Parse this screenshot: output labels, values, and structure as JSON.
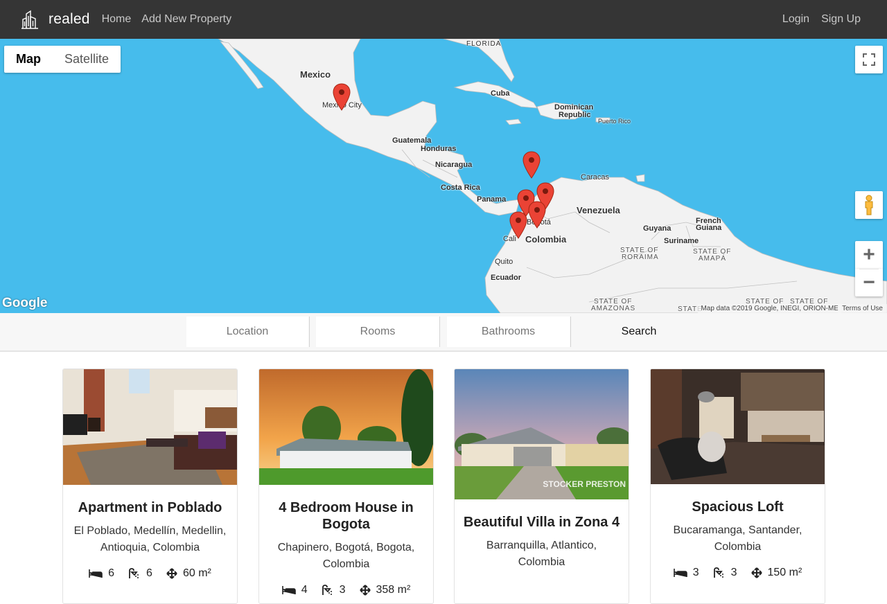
{
  "nav": {
    "brand": "realed",
    "links": [
      "Home",
      "Add New Property"
    ],
    "right_links": [
      "Login",
      "Sign Up"
    ]
  },
  "map": {
    "type_controls": [
      "Map",
      "Satellite"
    ],
    "labels": {
      "florida": "FLORIDA",
      "mexico": "Mexico",
      "mexico_city": "Mexico City",
      "cuba": "Cuba",
      "dominican_republic_1": "Dominican",
      "dominican_republic_2": "Republic",
      "puerto_rico": "Puerto Rico",
      "guatemala": "Guatemala",
      "honduras": "Honduras",
      "nicaragua": "Nicaragua",
      "costa_rica": "Costa Rica",
      "panama": "Panama",
      "caracas": "Caracas",
      "venezuela": "Venezuela",
      "bogota": "Bogotá",
      "cali": "Cali",
      "colombia": "Colombia",
      "guyana": "Guyana",
      "suriname": "Suriname",
      "french_guiana_1": "French",
      "french_guiana_2": "Guiana",
      "state_roraima_1": "STATE OF",
      "state_roraima_2": "RORAIMA",
      "state_amapa_1": "STATE OF",
      "state_amapa_2": "AMAPÁ",
      "quito": "Quito",
      "ecuador": "Ecuador",
      "state_amazonas_1": "STATE OF",
      "state_amazonas_2": "AMAZONAS",
      "state_bottom": "STATE",
      "state_right_1": "STATE OF",
      "state_right_2": "STATE OF"
    },
    "google_logo": "Google",
    "attribution": "Map data ©2019 Google, INEGI, ORION-ME",
    "terms": "Terms of Use",
    "pin_color": "#ea4335"
  },
  "search": {
    "location_placeholder": "Location",
    "rooms_placeholder": "Rooms",
    "bathrooms_placeholder": "Bathrooms",
    "button": "Search"
  },
  "listings": [
    {
      "title": "Apartment in Poblado",
      "address": "El Poblado, Medellín, Medellin, Antioquia, Colombia",
      "rooms": "6",
      "baths": "6",
      "area": "60 m²"
    },
    {
      "title": "4 Bedroom House in Bogota",
      "address": "Chapinero, Bogotá, Bogota, Colombia",
      "rooms": "4",
      "baths": "3",
      "area": "358 m²"
    },
    {
      "title": "Beautiful Villa in Zona 4",
      "address": "Barranquilla, Atlantico, Colombia",
      "watermark": "STOCKER PRESTON"
    },
    {
      "title": "Spacious Loft",
      "address": "Bucaramanga, Santander, Colombia",
      "rooms": "3",
      "baths": "3",
      "area": "150 m²"
    }
  ]
}
